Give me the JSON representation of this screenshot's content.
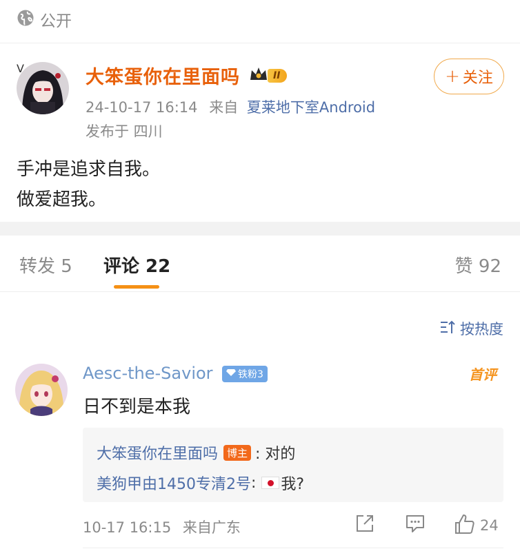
{
  "header": {
    "visibility_label": "公开",
    "icon": "globe-icon"
  },
  "post": {
    "author": {
      "name": "大笨蛋你在里面吗",
      "verified_badge": "V",
      "vip_level": "II"
    },
    "timestamp": "24-10-17 16:14",
    "source_prefix": "来自",
    "source": "夏莱地下室Android",
    "location": "发布于 四川",
    "follow_button": {
      "plus": "+",
      "label": "关注"
    },
    "content_lines": [
      "手冲是追求自我。",
      "做爱超我。"
    ]
  },
  "tabs": {
    "repost": "转发 5",
    "comment": "评论 22",
    "like": "赞 92"
  },
  "sort": {
    "label": "按热度",
    "icon": "sort-icon"
  },
  "comment": {
    "user": "Aesc-the-Savior",
    "fan_badge": "铁粉3",
    "first_label": "首评",
    "text": "日不到是本我",
    "replies": [
      {
        "name": "大笨蛋你在里面吗",
        "tag": "博主",
        "text": ": 对的"
      },
      {
        "name": "美狗甲由1450专清2号",
        "text": ": ",
        "suffix": "我?"
      }
    ],
    "time": "10-17 16:15",
    "location": "来自广东",
    "likes": "24"
  },
  "colors": {
    "accent_orange": "#e8600a",
    "link_blue": "#4e6ea8",
    "muted_gray": "#8a8a8a",
    "tab_indicator": "#f59015"
  }
}
